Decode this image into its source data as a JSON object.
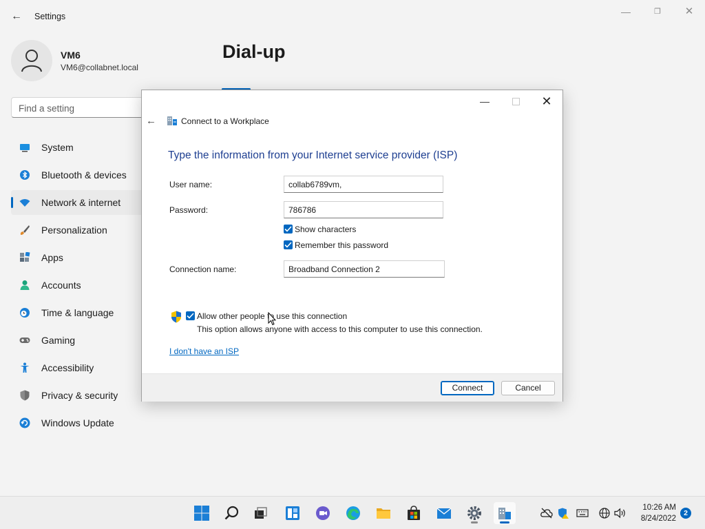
{
  "window": {
    "title": "Settings"
  },
  "profile": {
    "name": "VM6",
    "email": "VM6@collabnet.local"
  },
  "search": {
    "placeholder": "Find a setting"
  },
  "nav": {
    "items": [
      {
        "label": "System",
        "icon": "monitor-icon",
        "color": "#0078d4"
      },
      {
        "label": "Bluetooth & devices",
        "icon": "bluetooth-icon",
        "color": "#0078d4"
      },
      {
        "label": "Network & internet",
        "icon": "wifi-icon",
        "color": "#0078d4",
        "active": true
      },
      {
        "label": "Personalization",
        "icon": "brush-icon",
        "color": "#c47a2c"
      },
      {
        "label": "Apps",
        "icon": "apps-icon",
        "color": "#5a6b7b"
      },
      {
        "label": "Accounts",
        "icon": "person-icon",
        "color": "#1aa37a"
      },
      {
        "label": "Time & language",
        "icon": "clock-globe-icon",
        "color": "#0078d4"
      },
      {
        "label": "Gaming",
        "icon": "gamepad-icon",
        "color": "#6b6b6b"
      },
      {
        "label": "Accessibility",
        "icon": "accessibility-icon",
        "color": "#0078d4"
      },
      {
        "label": "Privacy & security",
        "icon": "shield-icon",
        "color": "#7a7a7a"
      },
      {
        "label": "Windows Update",
        "icon": "update-icon",
        "color": "#0078d4"
      }
    ]
  },
  "page": {
    "title": "Dial-up"
  },
  "dialog": {
    "title": "Connect to a Workplace",
    "heading": "Type the information from your Internet service provider (ISP)",
    "username_label": "User name:",
    "username_value": "collab6789vm,",
    "password_label": "Password:",
    "password_value": "786786",
    "show_characters": "Show characters",
    "remember_password": "Remember this password",
    "connection_name_label": "Connection name:",
    "connection_name_value": "Broadband Connection 2",
    "allow_others": "Allow other people to use this connection",
    "allow_note": "This option allows anyone with access to this computer to use this connection.",
    "no_isp_link": "I don't have an ISP",
    "connect_label": "Connect",
    "cancel_label": "Cancel"
  },
  "taskbar": {
    "apps": [
      "start-icon",
      "search-icon",
      "task-view-icon",
      "widgets-icon",
      "chat-icon",
      "edge-icon",
      "file-explorer-icon",
      "store-icon",
      "mail-icon",
      "settings-icon",
      "workplace-connection-icon"
    ],
    "time": "10:26 AM",
    "date": "8/24/2022",
    "notifications": "2"
  },
  "colors": {
    "accent": "#0067c0",
    "heading": "#1e3f91"
  }
}
